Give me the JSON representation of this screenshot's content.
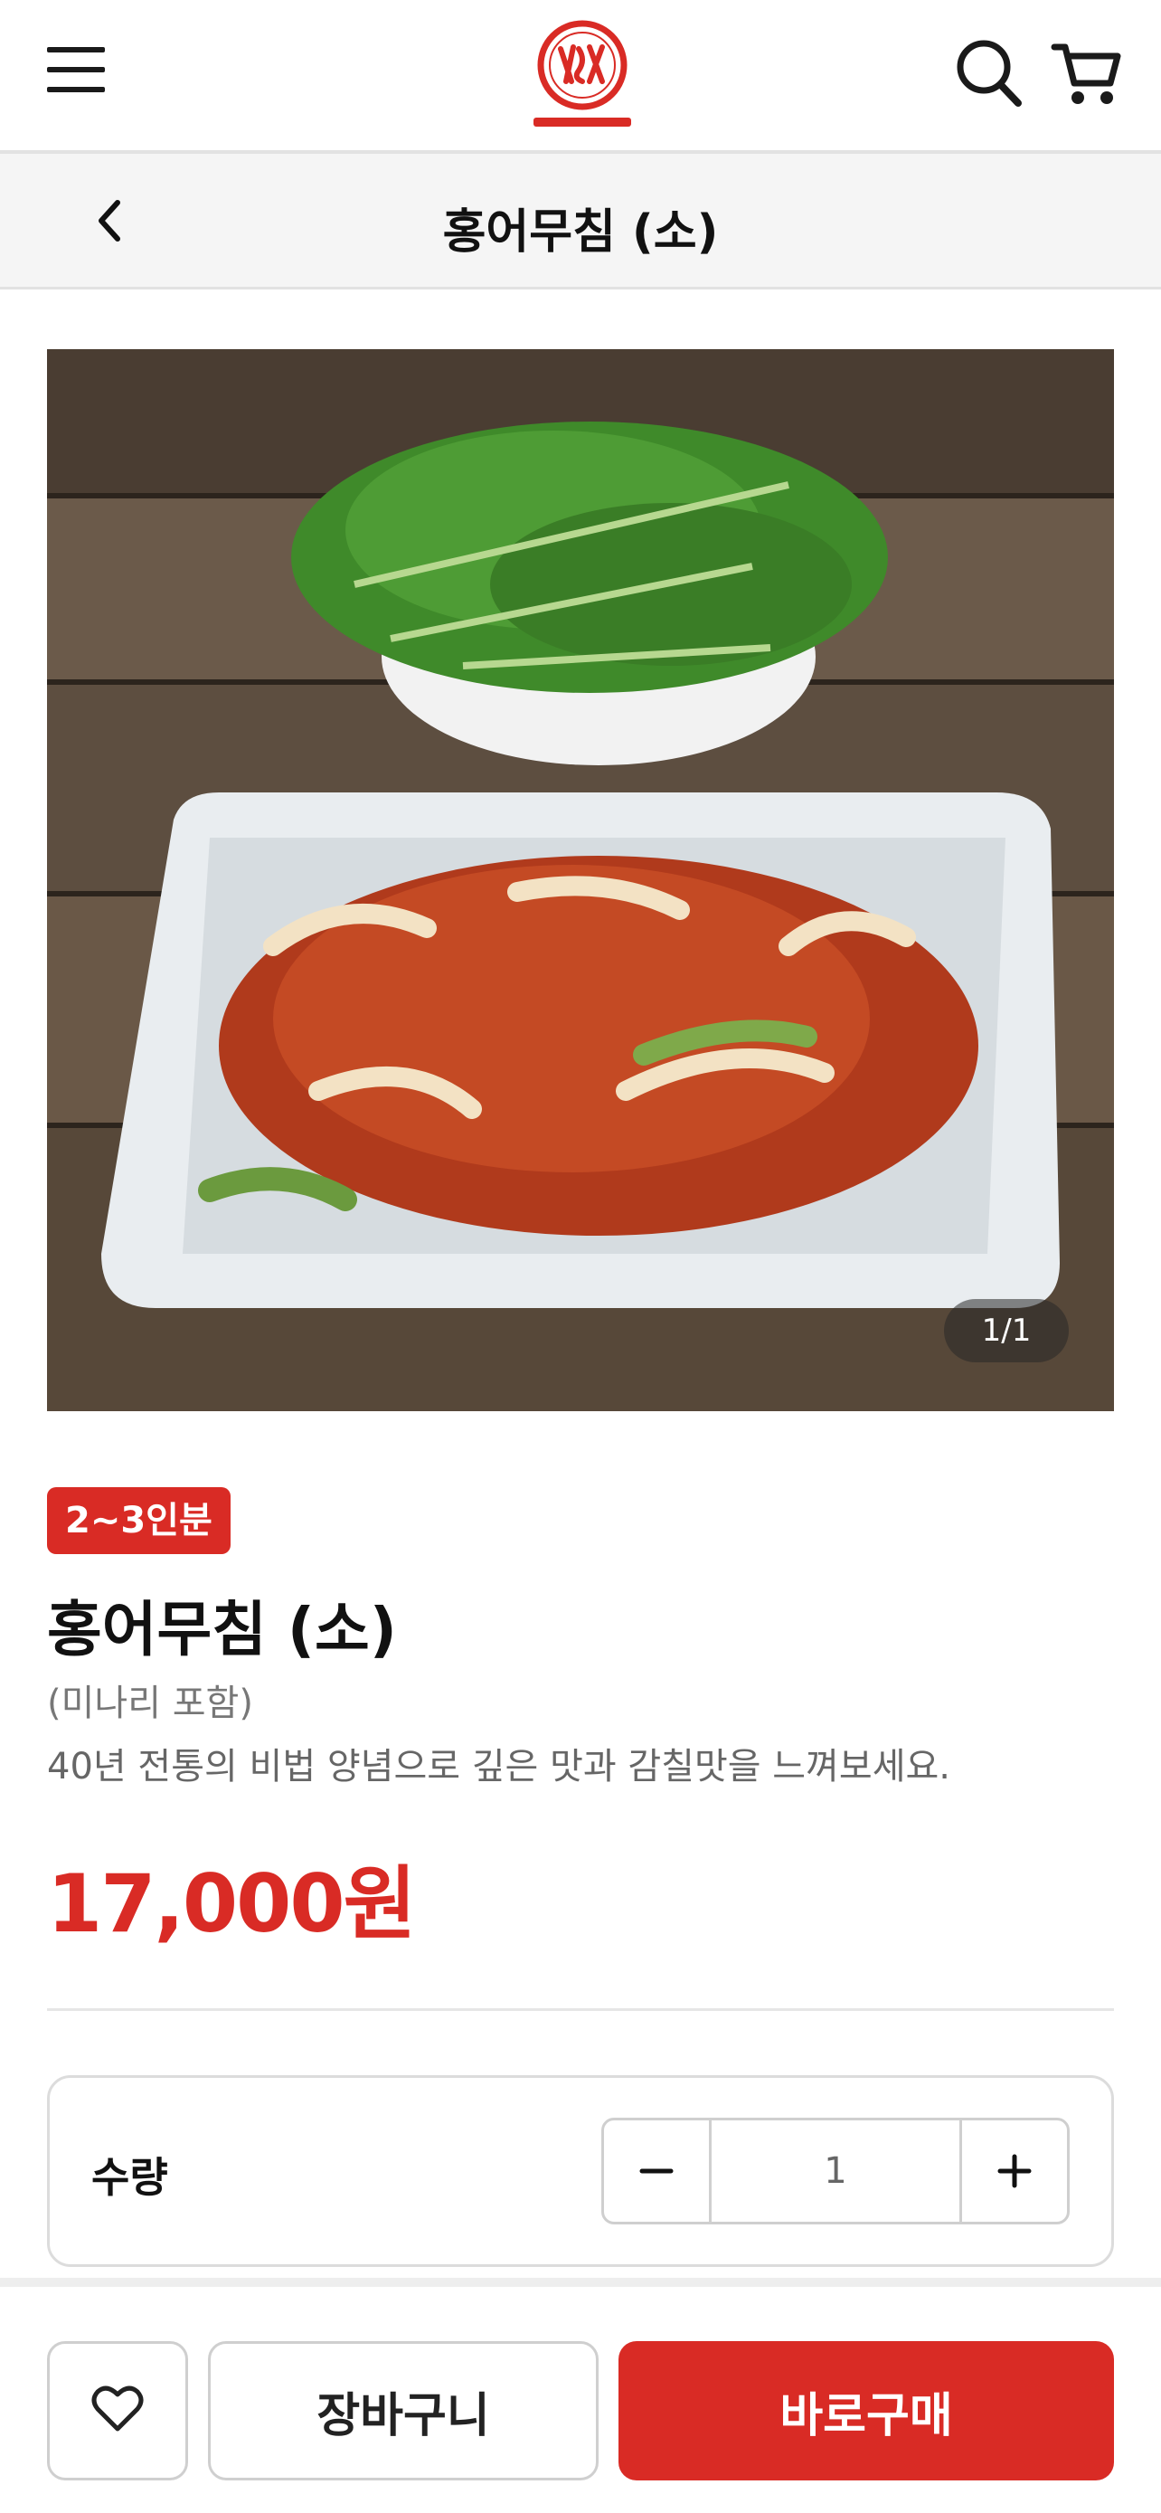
{
  "header": {
    "menu_icon": "hamburger-menu-icon",
    "logo_icon": "brand-logo-icon",
    "logo_lettering": "단현원조 홍어무침",
    "search_icon": "search-icon",
    "cart_icon": "cart-icon"
  },
  "subheader": {
    "back_icon": "chevron-left-icon",
    "title": "홍어무침 (소)"
  },
  "image": {
    "counter": "1/1"
  },
  "product": {
    "badge": "2~3인분",
    "name": "홍어무침 (소)",
    "note": "(미나리 포함)",
    "description": "40년 전통의 비법 양념으로 깊은 맛과 감칠맛을 느껴보세요.",
    "price": "17,000원"
  },
  "quantity": {
    "label": "수량",
    "value": "1",
    "minus_icon": "minus-icon",
    "plus_icon": "plus-icon"
  },
  "actions": {
    "wish_icon": "heart-icon",
    "cart_label": "장바구니",
    "buy_label": "바로구매"
  },
  "colors": {
    "accent": "#d92b25",
    "border": "#cfcfcf",
    "subheader_bg": "#f5f5f5"
  }
}
